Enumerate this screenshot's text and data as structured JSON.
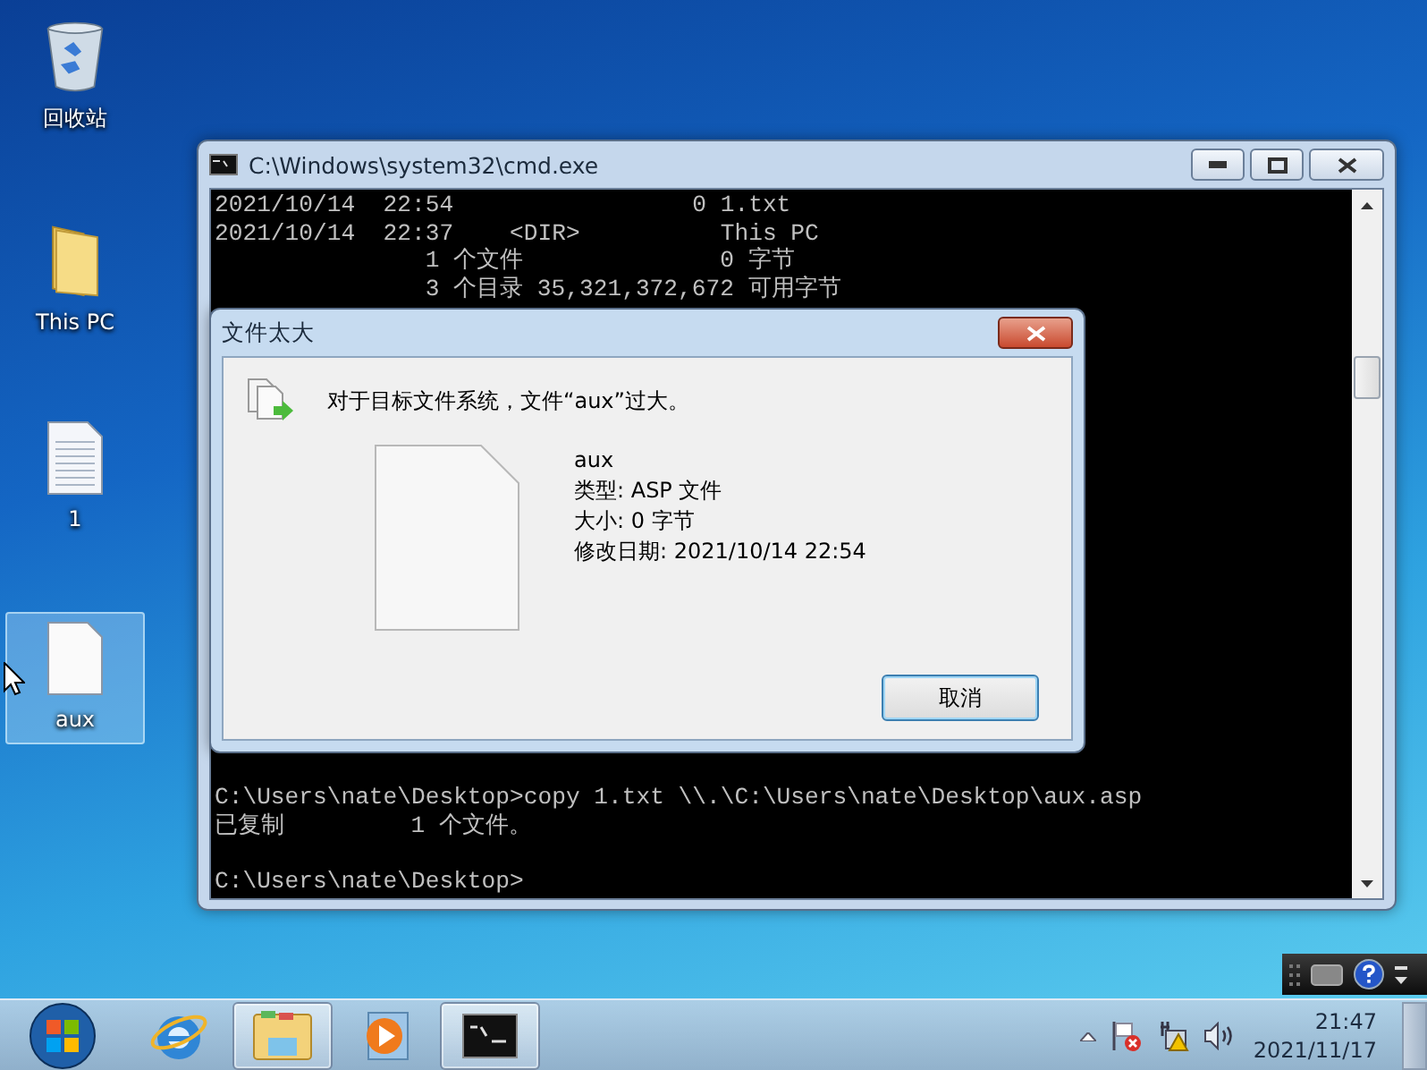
{
  "desktop_icons": [
    {
      "kind": "recycle",
      "label": "回收站",
      "selected": false
    },
    {
      "kind": "folder",
      "label": "This PC",
      "selected": false
    },
    {
      "kind": "text",
      "label": "1",
      "selected": false
    },
    {
      "kind": "blank",
      "label": "aux",
      "selected": true
    }
  ],
  "console_window": {
    "title": "C:\\Windows\\system32\\cmd.exe",
    "top_lines": [
      "2021/10/14  22:54                 0 1.txt",
      "2021/10/14  22:37    <DIR>          This PC",
      "               1 个文件              0 字节",
      "               3 个目录 35,321,372,672 可用字节"
    ],
    "command_lines": [
      "C:\\Users\\nate\\Desktop>copy 1.txt \\\\.\\C:\\Users\\nate\\Desktop\\aux.asp",
      "已复制         1 个文件。"
    ],
    "prompt": "C:\\Users\\nate\\Desktop>"
  },
  "dialog": {
    "title": "文件太大",
    "message": "对于目标文件系统，文件“aux”过大。",
    "file_details": [
      "aux",
      "类型: ASP 文件",
      "大小: 0 字节",
      "修改日期: 2021/10/14 22:54"
    ],
    "button": "取消"
  },
  "taskbar": {
    "items": [
      {
        "kind": "browser",
        "running": false
      },
      {
        "kind": "explorer",
        "running": true
      },
      {
        "kind": "media",
        "running": false
      },
      {
        "kind": "console",
        "running": true
      }
    ],
    "clock_time": "21:47",
    "clock_date": "2021/11/17"
  }
}
